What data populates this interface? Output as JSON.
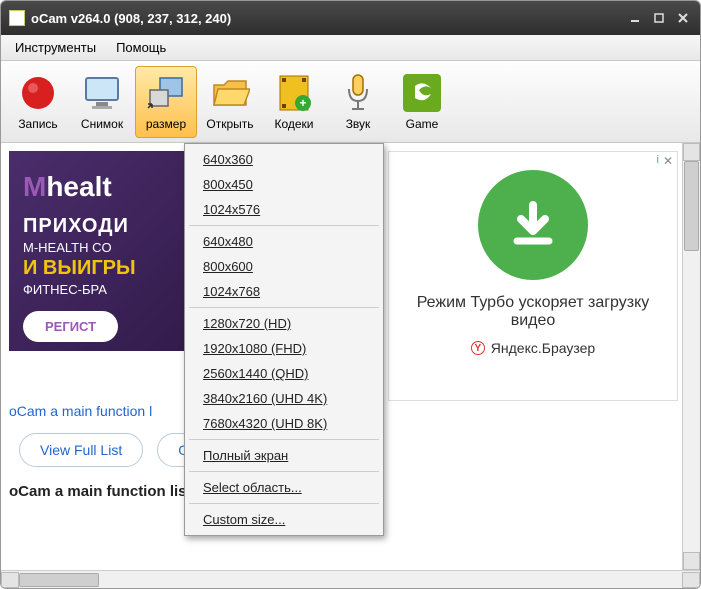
{
  "title": "oCam v264.0 (908, 237, 312, 240)",
  "menubar": {
    "tools": "Инструменты",
    "help": "Помощь"
  },
  "toolbar": {
    "record": "Запись",
    "snapshot": "Снимок",
    "size": "размер",
    "open": "Открыть",
    "codecs": "Кодеки",
    "sound": "Звук",
    "game": "Game"
  },
  "dropdown": {
    "g1": [
      "640x360",
      "800x450",
      "1024x576"
    ],
    "g2": [
      "640x480",
      "800x600",
      "1024x768"
    ],
    "g3": [
      "1280x720 (HD)",
      "1920x1080 (FHD)",
      "2560x1440 (QHD)",
      "3840x2160 (UHD 4K)",
      "7680x4320 (UHD 8K)"
    ],
    "fullscreen": "Полный экран",
    "select_area": "Select область...",
    "custom": "Custom size..."
  },
  "left_ad": {
    "logo_prefix": "M",
    "logo_rest": "healt",
    "line1": "ПРИХОДИ",
    "line2": "M-HEALTH CO",
    "line3": "И ВЫИГРЫ",
    "line4": "ФИТНЕС-БРА",
    "button": "РЕГИСТ"
  },
  "right_ad": {
    "info_icon": "i",
    "text1": "Режим Турбо ускоряет загрузку видео",
    "brand_letter": "Y",
    "brand": "Яндекс.Браузер"
  },
  "blue_link": "oCam a main function l",
  "pill1": "View Full List",
  "pill2": "O",
  "heading": "oCam a main function list"
}
